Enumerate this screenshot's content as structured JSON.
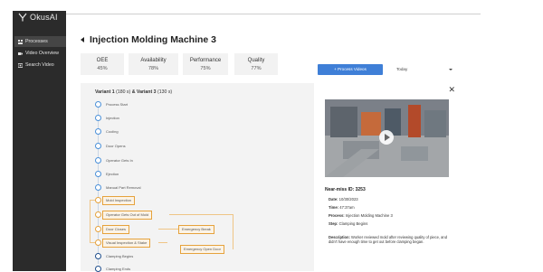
{
  "app": {
    "brand": "OkusAI"
  },
  "sidebar": {
    "items": [
      {
        "label": "Processes",
        "icon": "processes-icon",
        "active": true
      },
      {
        "label": "Video Overview",
        "icon": "video-icon",
        "active": false
      },
      {
        "label": "Search Video",
        "icon": "search-icon",
        "active": false
      }
    ]
  },
  "header": {
    "title": "Injection Molding Machine 3"
  },
  "metrics": [
    {
      "label": "OEE",
      "value": "45%"
    },
    {
      "label": "Availability",
      "value": "78%"
    },
    {
      "label": "Performance",
      "value": "75%"
    },
    {
      "label": "Quality",
      "value": "77%"
    }
  ],
  "toolbar": {
    "process_button": "+ Process Videos",
    "date_select": "Today"
  },
  "flow": {
    "variant_a": "Variant 1",
    "variant_a_count": "(180 s)",
    "amp": "&",
    "variant_b": "Variant 3",
    "variant_b_count": "(130 s)",
    "steps": [
      "Process Start",
      "Injection",
      "Cooling",
      "Door Opens",
      "Operator Gets In",
      "Ejection",
      "Manual Part Removal",
      "Mold Inspection",
      "Operator Gets Out of Mold",
      "Door Closes",
      "Visual Inspection & Stake",
      "Clamping Begins",
      "Clamping Ends"
    ],
    "side_boxes": [
      "Emergency Break",
      "Emergency Open Door"
    ]
  },
  "detail": {
    "title": "Near-miss ID: 3253",
    "date_label": "Date:",
    "date_value": "10/30/2023",
    "time_label": "Time:",
    "time_value": "47:37am",
    "process_label": "Process:",
    "process_value": "Injection Molding Machine 3",
    "step_label": "Step:",
    "step_value": "Clamping Begins",
    "desc_label": "Description:",
    "desc_value": "Worker reviewed mold after reviewing quality of piece, and didn't have enough time to get out before clamping began."
  },
  "colors": {
    "accent": "#3f7fd7",
    "sidebar": "#2b2b2b",
    "flow_node": "#4a90d9",
    "flow_highlight": "#e6a23c"
  }
}
